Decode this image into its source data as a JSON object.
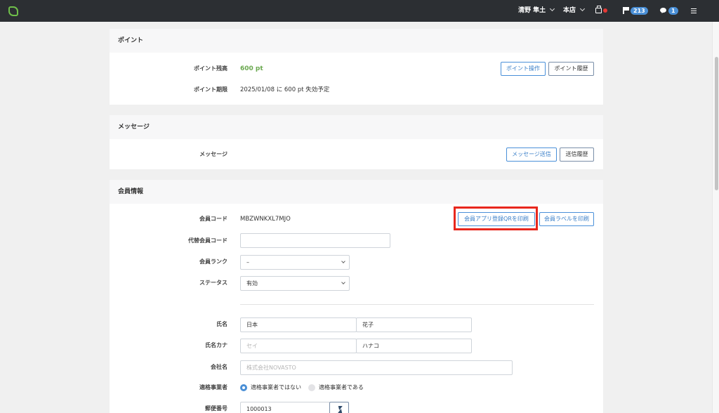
{
  "header": {
    "user_name": "清野 隼土",
    "store_name": "本店",
    "notifications_count": "213",
    "messages_count": "1"
  },
  "points": {
    "section_title": "ポイント",
    "balance_label": "ポイント残高",
    "balance_value": "600 pt",
    "expiry_label": "ポイント期限",
    "expiry_value": "2025/01/08 に 600 pt 失効予定",
    "operate_button": "ポイント操作",
    "history_button": "ポイント履歴"
  },
  "messages": {
    "section_title": "メッセージ",
    "label": "メッセージ",
    "send_button": "メッセージ送信",
    "history_button": "送信履歴"
  },
  "member": {
    "section_title": "会員情報",
    "code_label": "会員コード",
    "code_value": "MBZWNKXL7MJO",
    "print_qr_button": "会員アプリ登録QRを印刷",
    "print_label_button": "会員ラベルを印刷",
    "alt_code_label": "代替会員コード",
    "alt_code_value": "",
    "rank_label": "会員ランク",
    "rank_value": "–",
    "status_label": "ステータス",
    "status_value": "有効",
    "name_label": "氏名",
    "last_name": "日本",
    "first_name": "花子",
    "kana_label": "氏名カナ",
    "kana_last_placeholder": "セイ",
    "kana_first": "ハナコ",
    "company_label": "会社名",
    "company_placeholder": "株式会社NOVASTO",
    "qualified_label": "適格事業者",
    "qualified_option_no": "適格事業者ではない",
    "qualified_option_yes": "適格事業者である",
    "qualified_selected": "no",
    "postal_label": "郵便番号",
    "postal_value": "1000013"
  },
  "colors": {
    "topbar": "#2c2f33",
    "accent": "#4a8fd6",
    "points_green": "#6aa84f",
    "highlight_red": "#e8271d"
  }
}
